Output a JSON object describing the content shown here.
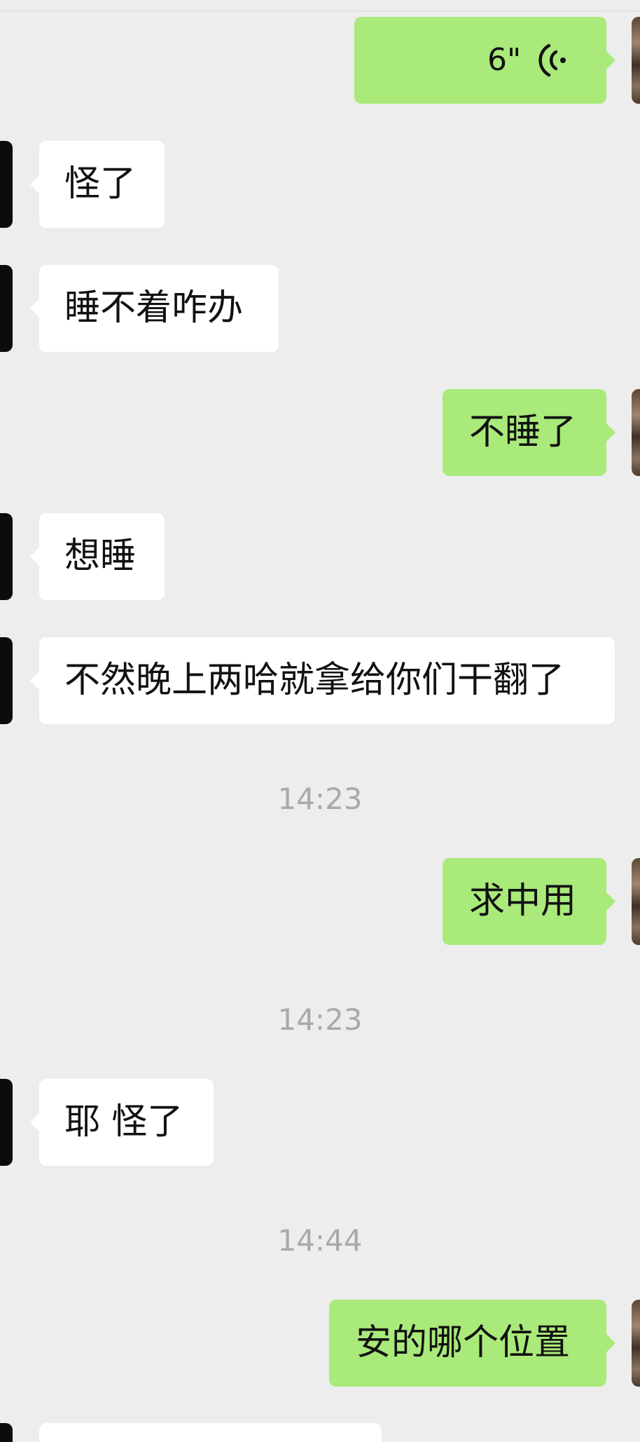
{
  "messages": {
    "m1": {
      "duration": "6\""
    },
    "m2": {
      "text": "怪了"
    },
    "m3": {
      "text": "睡不着咋办"
    },
    "m4": {
      "text": "不睡了"
    },
    "m5": {
      "text": "想睡"
    },
    "m6": {
      "text": "不然晚上两哈就拿给你们干翻了"
    },
    "m7": {
      "text": "求中用"
    },
    "m8": {
      "text": "耶 怪了"
    },
    "m9": {
      "text": "安的哪个位置"
    }
  },
  "timestamps": {
    "t1": "14:23",
    "t2": "14:23",
    "t3": "14:44"
  },
  "colors": {
    "background": "#ededed",
    "outgoing_bubble": "#a9ea7a",
    "incoming_bubble": "#ffffff",
    "timestamp_text": "#a9a9a9"
  },
  "icons": {
    "voice": "voice-wave-icon"
  }
}
